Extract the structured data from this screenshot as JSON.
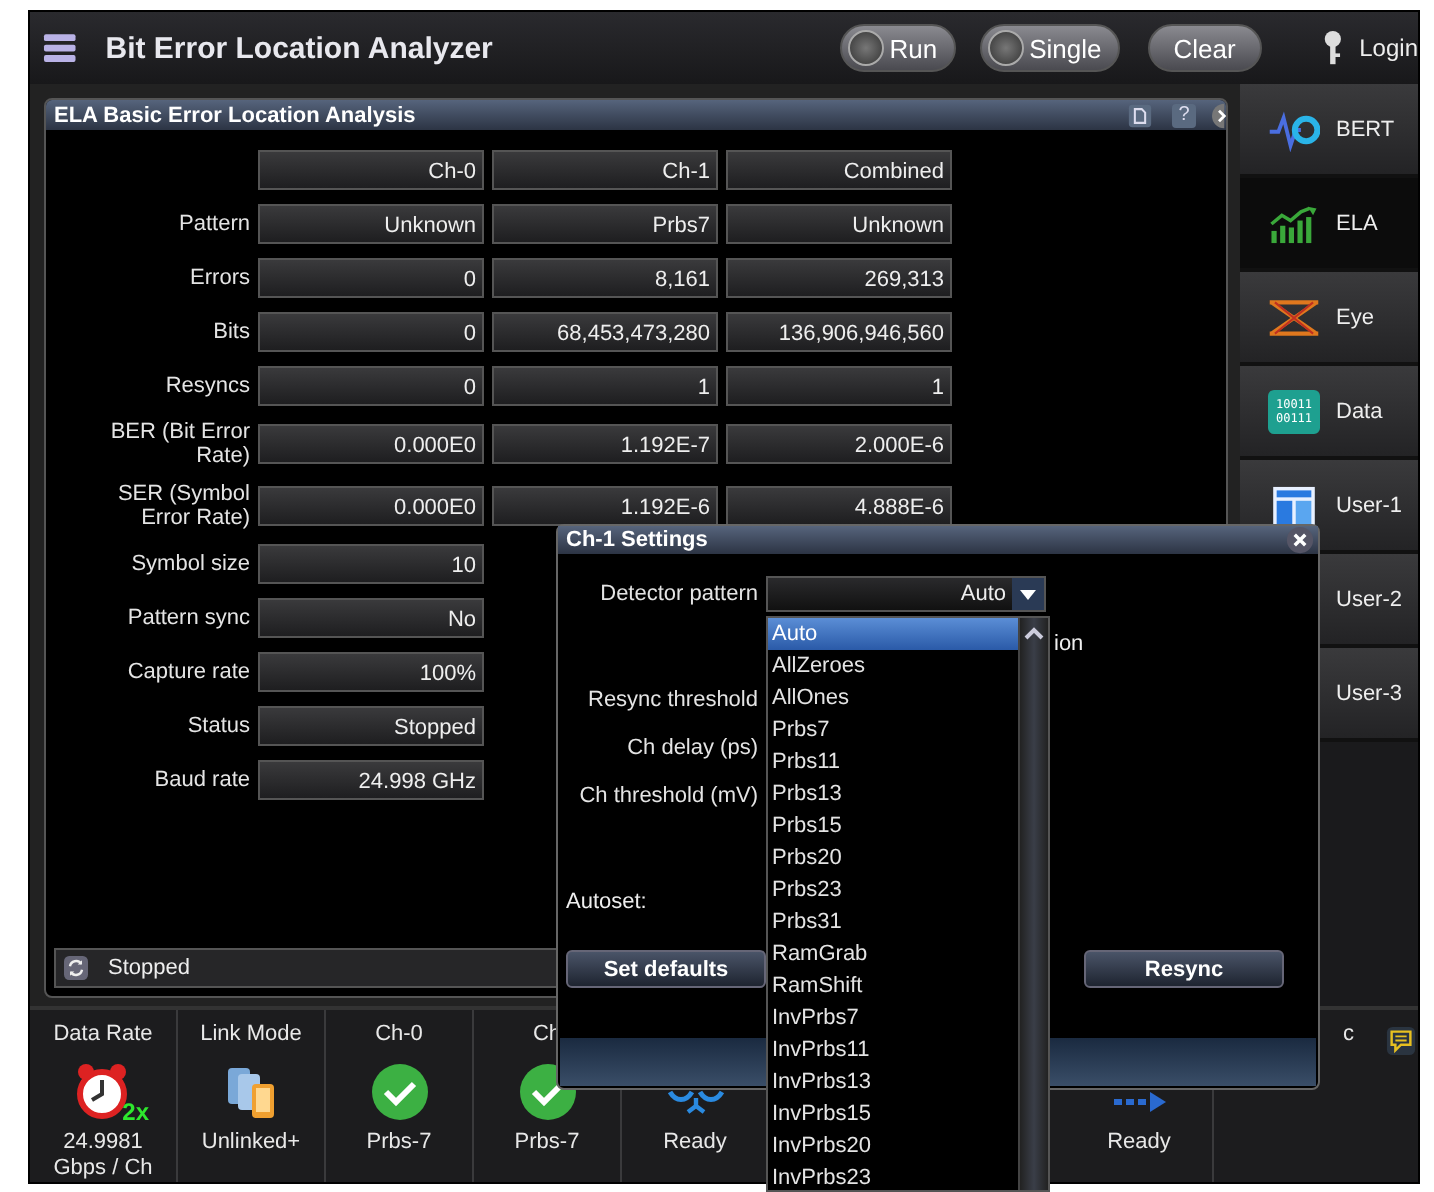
{
  "header": {
    "title": "Bit Error Location Analyzer",
    "buttons": [
      {
        "label": "Run",
        "kind": "led"
      },
      {
        "label": "Single",
        "kind": "led"
      },
      {
        "label": "Clear",
        "kind": "plain"
      }
    ],
    "login": "Login"
  },
  "panel": {
    "title": "ELA Basic Error Location Analysis",
    "help": "?",
    "columns": [
      "Ch-0",
      "Ch-1",
      "Combined"
    ],
    "rows": [
      {
        "label": "Pattern",
        "values": [
          "Unknown",
          "Prbs7",
          "Unknown"
        ]
      },
      {
        "label": "Errors",
        "values": [
          "0",
          "8,161",
          "269,313"
        ]
      },
      {
        "label": "Bits",
        "values": [
          "0",
          "68,453,473,280",
          "136,906,946,560"
        ]
      },
      {
        "label": "Resyncs",
        "values": [
          "0",
          "1",
          "1"
        ]
      },
      {
        "label": "BER (Bit Error Rate)",
        "values": [
          "0.000E0",
          "1.192E-7",
          "2.000E-6"
        ]
      },
      {
        "label": "SER (Symbol Error Rate)",
        "values": [
          "0.000E0",
          "1.192E-6",
          "4.888E-6"
        ]
      },
      {
        "label": "Symbol size",
        "values": [
          "10"
        ]
      },
      {
        "label": "Pattern sync",
        "values": [
          "No"
        ]
      },
      {
        "label": "Capture rate",
        "values": [
          "100%"
        ]
      },
      {
        "label": "Status",
        "values": [
          "Stopped"
        ]
      },
      {
        "label": "Baud rate",
        "values": [
          "24.998 GHz"
        ]
      }
    ],
    "status": "Stopped"
  },
  "sidebar": {
    "tabs": [
      {
        "label": "BERT",
        "kind": "bert",
        "selected": false
      },
      {
        "label": "ELA",
        "kind": "ela",
        "selected": true
      },
      {
        "label": "Eye",
        "kind": "eye",
        "selected": false
      },
      {
        "label": "Data",
        "kind": "data",
        "icon_text": [
          "10011",
          "00111"
        ],
        "selected": false
      },
      {
        "label": "User-1",
        "kind": "layout",
        "selected": false
      },
      {
        "label": "User-2",
        "selected": false
      },
      {
        "label": "User-3",
        "selected": false
      }
    ]
  },
  "bottom": {
    "cells": [
      {
        "label": "Data Rate",
        "kind": "clock",
        "badge": "2x",
        "value": "24.9981 Gbps / Ch"
      },
      {
        "label": "Link Mode",
        "kind": "devices",
        "value": "Unlinked+"
      },
      {
        "label": "Ch-0",
        "kind": "check",
        "value": "Prbs-7"
      },
      {
        "label": "Ch",
        "kind": "check",
        "value": "Prbs-7"
      },
      {
        "kind": "scope",
        "value": "Ready"
      },
      {
        "kind": "arrow",
        "value": "Ready"
      },
      {
        "label": "c"
      }
    ]
  },
  "dialog": {
    "title": "Ch-1 Settings",
    "detector": {
      "label": "Detector pattern",
      "value": "Auto"
    },
    "partial_label": "ion",
    "fields": [
      "Resync threshold",
      "Ch delay (ps)",
      "Ch threshold (mV)"
    ],
    "autoset": "Autoset:",
    "buttons": [
      "Set defaults",
      "Resync"
    ],
    "options": [
      {
        "label": "Auto",
        "selected": true
      },
      {
        "label": "AllZeroes",
        "selected": false
      },
      {
        "label": "AllOnes",
        "selected": false
      },
      {
        "label": "Prbs7",
        "selected": false
      },
      {
        "label": "Prbs11",
        "selected": false
      },
      {
        "label": "Prbs13",
        "selected": false
      },
      {
        "label": "Prbs15",
        "selected": false
      },
      {
        "label": "Prbs20",
        "selected": false
      },
      {
        "label": "Prbs23",
        "selected": false
      },
      {
        "label": "Prbs31",
        "selected": false
      },
      {
        "label": "RamGrab",
        "selected": false
      },
      {
        "label": "RamShift",
        "selected": false
      },
      {
        "label": "InvPrbs7",
        "selected": false
      },
      {
        "label": "InvPrbs11",
        "selected": false
      },
      {
        "label": "InvPrbs13",
        "selected": false
      },
      {
        "label": "InvPrbs15",
        "selected": false
      },
      {
        "label": "InvPrbs20",
        "selected": false
      },
      {
        "label": "InvPrbs23",
        "selected": false
      }
    ]
  }
}
